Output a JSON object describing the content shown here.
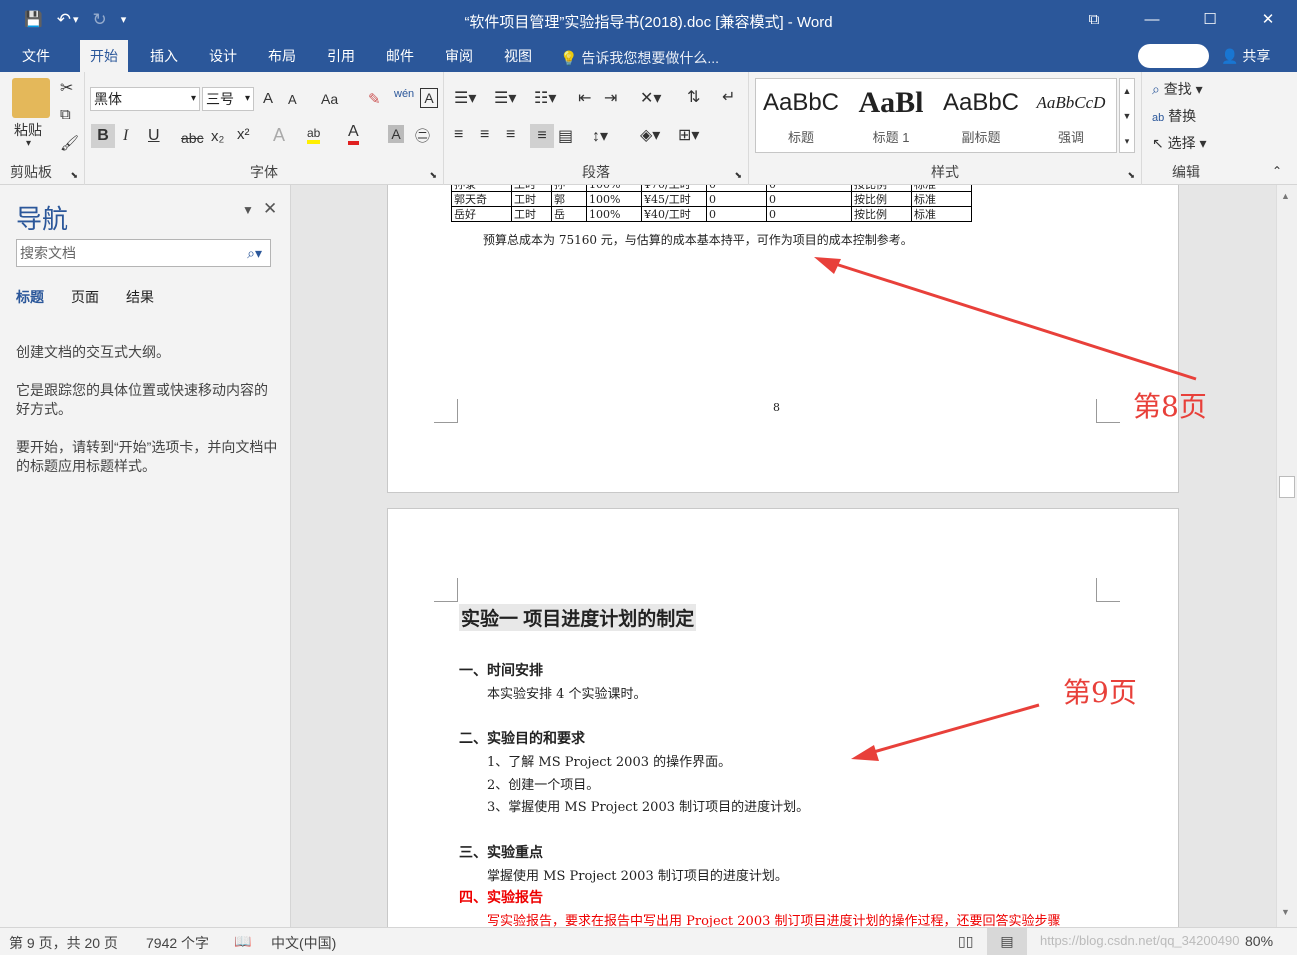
{
  "window": {
    "title": "“软件项目管理”实验指导书(2018).doc [兼容模式] - Word"
  },
  "qat": {
    "save": "💾",
    "undo": "↶",
    "undo_arrow": "▾",
    "redo": "↻",
    "customize": "▾"
  },
  "tabs": [
    "文件",
    "开始",
    "插入",
    "设计",
    "布局",
    "引用",
    "邮件",
    "审阅",
    "视图"
  ],
  "tell_me": "告诉我您想要做什么...",
  "share": "共享",
  "ribbon": {
    "clipboard": {
      "label": "剪贴板",
      "paste": "粘贴"
    },
    "font": {
      "label": "字体",
      "name": "黑体",
      "size": "三号",
      "grow": "A",
      "shrink": "A",
      "case": "Aa",
      "bold": "B",
      "italic": "I",
      "underline": "U",
      "strike": "abc",
      "sub": "x₂",
      "sup": "x²",
      "highlight": "ab",
      "color": "A",
      "charbox": "A"
    },
    "paragraph": {
      "label": "段落"
    },
    "styles": {
      "label": "样式",
      "items": [
        {
          "preview": "AaBbC",
          "name": "标题"
        },
        {
          "preview": "AaBl",
          "name": "标题 1"
        },
        {
          "preview": "AaBbC",
          "name": "副标题"
        },
        {
          "preview": "AaBbCcD",
          "name": "强调"
        }
      ]
    },
    "editing": {
      "label": "编辑",
      "find": "查找",
      "replace": "替换",
      "select": "选择"
    }
  },
  "nav": {
    "title": "导航",
    "search_placeholder": "搜索文档",
    "tabs": [
      "标题",
      "页面",
      "结果"
    ],
    "text": [
      "创建文档的交互式大纲。",
      "它是跟踪您的具体位置或快速移动内容的好方式。",
      "要开始，请转到“开始”选项卡，并向文档中的标题应用标题样式。"
    ]
  },
  "page8": {
    "table_rows": [
      [
        "孙录",
        "工时",
        "孙",
        "100%",
        "¥70/工时",
        "0",
        "0",
        "按比例",
        "标准"
      ],
      [
        "郭天奇",
        "工时",
        "郭",
        "100%",
        "¥45/工时",
        "0",
        "0",
        "按比例",
        "标准"
      ],
      [
        "岳好",
        "工时",
        "岳",
        "100%",
        "¥40/工时",
        "0",
        "0",
        "按比例",
        "标准"
      ]
    ],
    "summary": "预算总成本为 75160 元，与估算的成本基本持平，可作为项目的成本控制参考。",
    "page_number": "8"
  },
  "page9": {
    "title": "实验一  项目进度计划的制定",
    "s1_head": "一、时间安排",
    "s1_text": "本实验安排 4 个实验课时。",
    "s2_head": "二、实验目的和要求",
    "s2_items": [
      "1、了解 MS Project 2003 的操作界面。",
      "2、创建一个项目。",
      "3、掌握使用 MS Project 2003 制订项目的进度计划。"
    ],
    "s3_head": "三、实验重点",
    "s3_text": "掌握使用 MS Project 2003 制订项目的进度计划。",
    "s4_head": "四、实验报告",
    "s4_text": "写实验报告，要求在报告中写出用 Project 2003 制订项目进度计划的操作过程，还要回答实验步骤"
  },
  "annotations": {
    "page8": "第8页",
    "page9": "第9页"
  },
  "status": {
    "page": "第 9 页，共 20 页",
    "words": "7942 个字",
    "lang": "中文(中国)",
    "zoom": "80%",
    "watermark": "https://blog.csdn.net/qq_34200490"
  },
  "colors": {
    "ribbon": "#2b579a",
    "annotation": "#e8403a"
  }
}
